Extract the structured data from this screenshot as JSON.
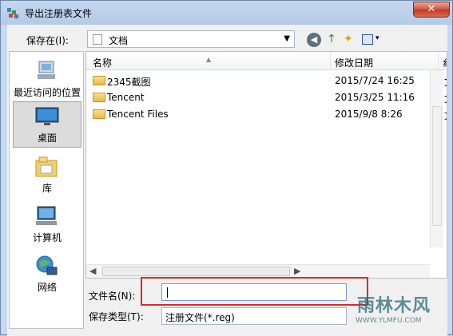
{
  "window": {
    "title": "导出注册表文件",
    "close_glyph": "✕"
  },
  "toolbar": {
    "save_in_label": "保存在(I):",
    "save_in_value": "文档",
    "back_glyph": "◀",
    "up_glyph": "↑",
    "new_folder_glyph": "✦",
    "view_caret": "▾"
  },
  "places": [
    {
      "label": "最近访问的位置",
      "icon": "recent-places-icon"
    },
    {
      "label": "桌面",
      "icon": "desktop-icon"
    },
    {
      "label": "库",
      "icon": "library-icon"
    },
    {
      "label": "计算机",
      "icon": "computer-icon"
    },
    {
      "label": "网络",
      "icon": "network-icon"
    }
  ],
  "file_list": {
    "columns": {
      "name": "名称",
      "modified": "修改日期",
      "extra": "纟"
    },
    "sort_glyph": "▲",
    "rows": [
      {
        "name": "2345截图",
        "modified": "2015/7/24 16:25",
        "extra": "文"
      },
      {
        "name": "Tencent",
        "modified": "2015/3/25 11:16",
        "extra": "文"
      },
      {
        "name": "Tencent Files",
        "modified": "2015/9/8 8:26",
        "extra": "文"
      }
    ]
  },
  "scroll": {
    "left_glyph": "◀",
    "right_glyph": "▶"
  },
  "file_name": {
    "label": "文件名(N):",
    "value": ""
  },
  "file_type": {
    "label": "保存类型(T):",
    "value": "注册文件(*.reg)"
  },
  "watermark": {
    "main": "雨林木风",
    "url": "WWW.YLMFU.COM"
  },
  "colors": {
    "highlight": "#e0262b",
    "title_bar": "#c4d7ee",
    "close_button": "#c23923"
  }
}
